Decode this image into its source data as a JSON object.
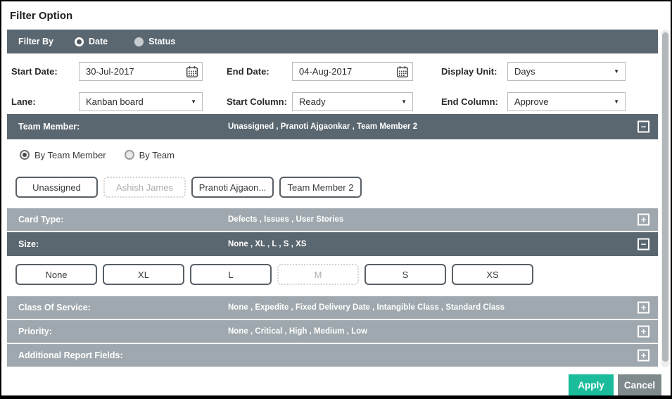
{
  "dialog": {
    "title": "Filter Option"
  },
  "filter_by": {
    "label": "Filter By",
    "options": [
      {
        "label": "Date",
        "selected": true
      },
      {
        "label": "Status",
        "selected": false
      }
    ]
  },
  "date_row": {
    "start_date_label": "Start Date:",
    "start_date_value": "30-Jul-2017",
    "end_date_label": "End Date:",
    "end_date_value": "04-Aug-2017",
    "display_unit_label": "Display Unit:",
    "display_unit_value": "Days"
  },
  "lane_row": {
    "lane_label": "Lane:",
    "lane_value": "Kanban board",
    "start_column_label": "Start Column:",
    "start_column_value": "Ready",
    "end_column_label": "End Column:",
    "end_column_value": "Approve"
  },
  "team_member_section": {
    "label": "Team Member:",
    "summary": "Unassigned , Pranoti Ajgaonkar , Team Member 2",
    "collapse_icon": "−",
    "mode_options": [
      {
        "label": "By Team Member",
        "selected": true
      },
      {
        "label": "By Team",
        "selected": false
      }
    ],
    "members": [
      {
        "label": "Unassigned",
        "selected": true
      },
      {
        "label": "Ashish James",
        "selected": false
      },
      {
        "label": "Pranoti Ajgaon...",
        "selected": true
      },
      {
        "label": "Team Member 2",
        "selected": true
      }
    ]
  },
  "card_type_section": {
    "label": "Card Type:",
    "summary": "Defects , Issues , User Stories",
    "expand_icon": "+"
  },
  "size_section": {
    "label": "Size:",
    "summary": "None , XL , L , S , XS",
    "collapse_icon": "−",
    "options": [
      {
        "label": "None",
        "selected": true
      },
      {
        "label": "XL",
        "selected": true
      },
      {
        "label": "L",
        "selected": true
      },
      {
        "label": "M",
        "selected": false
      },
      {
        "label": "S",
        "selected": true
      },
      {
        "label": "XS",
        "selected": true
      }
    ]
  },
  "class_of_service_section": {
    "label": "Class Of Service:",
    "summary": "None , Expedite , Fixed Delivery Date , Intangible Class , Standard Class",
    "expand_icon": "+"
  },
  "priority_section": {
    "label": "Priority:",
    "summary": "None , Critical , High , Medium , Low",
    "expand_icon": "+"
  },
  "additional_report_fields_section": {
    "label": "Additional Report Fields:",
    "summary": "",
    "expand_icon": "+"
  },
  "footer": {
    "apply_label": "Apply",
    "cancel_label": "Cancel"
  },
  "colors": {
    "dark_bar": "#5b6770",
    "light_bar": "#9fa8ae",
    "apply_button": "#1abc9c",
    "cancel_button": "#7f8a8d"
  }
}
